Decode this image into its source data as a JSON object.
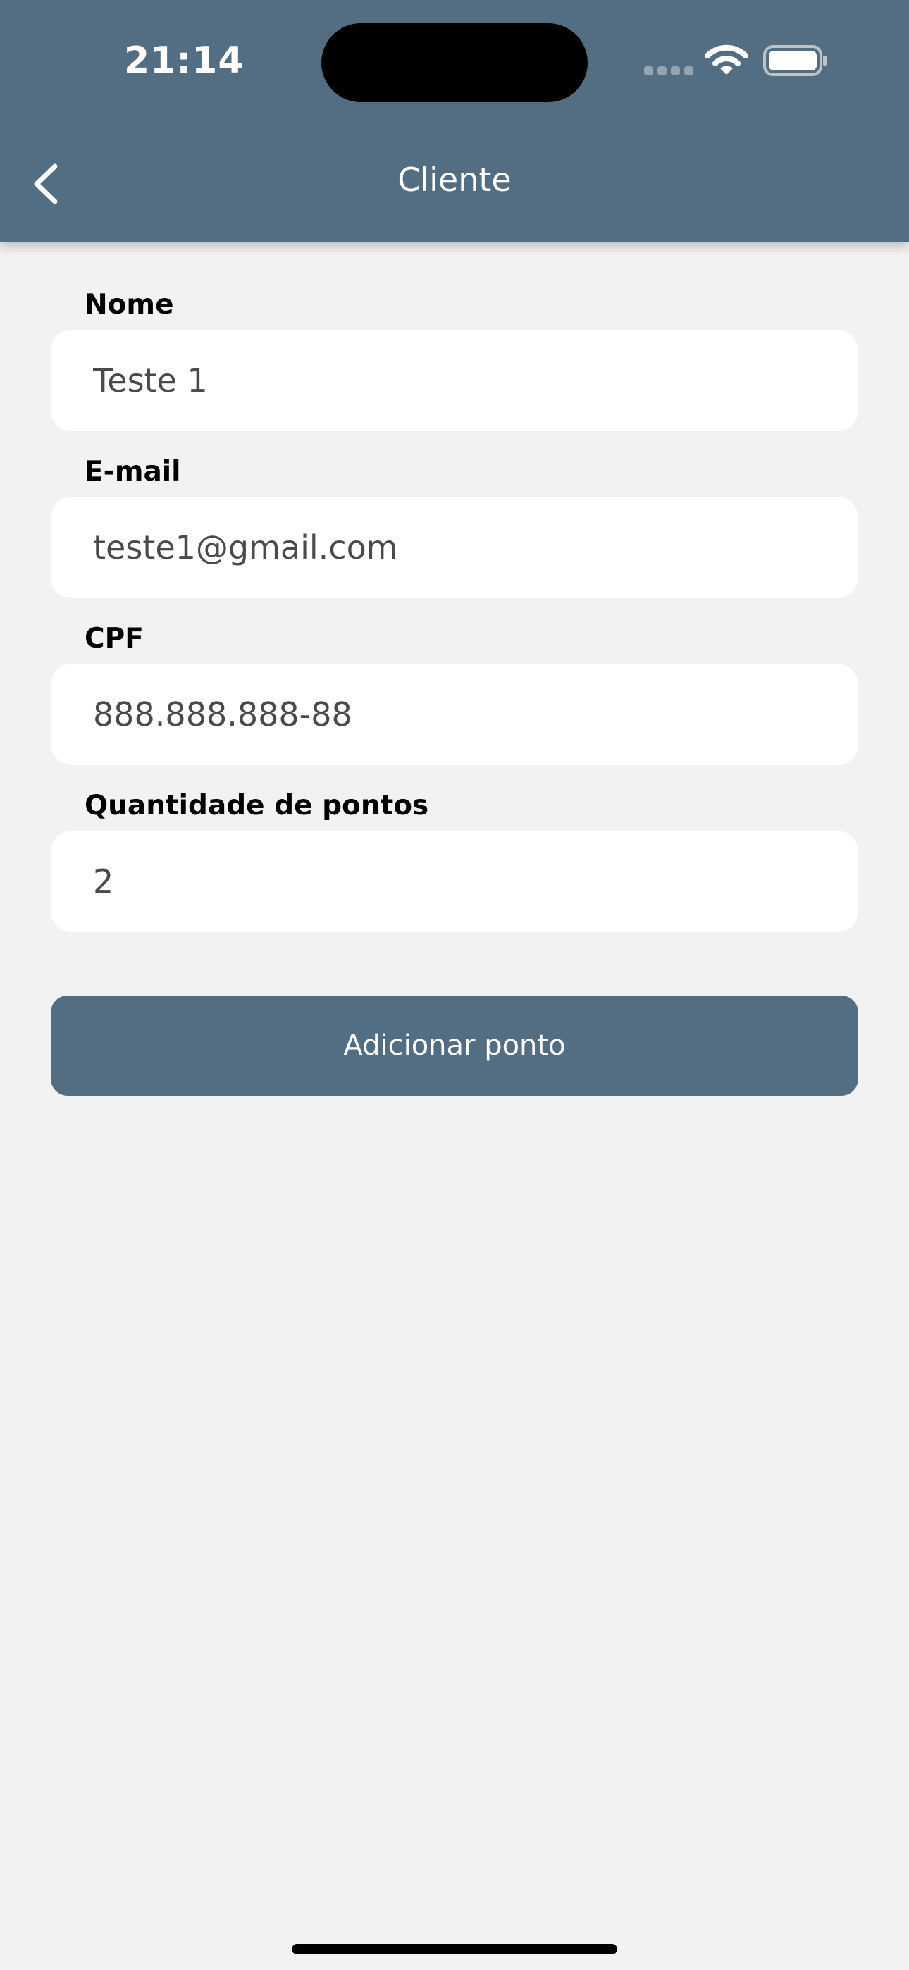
{
  "status_bar": {
    "time": "21:14"
  },
  "nav": {
    "title": "Cliente",
    "back_icon": "chevron-left-icon"
  },
  "form": {
    "nome": {
      "label": "Nome",
      "value": "Teste 1"
    },
    "email": {
      "label": "E-mail",
      "value": "teste1@gmail.com"
    },
    "cpf": {
      "label": "CPF",
      "value": "888.888.888-88"
    },
    "pontos": {
      "label": "Quantidade de pontos",
      "value": "2"
    }
  },
  "actions": {
    "add_point_label": "Adicionar ponto"
  },
  "colors": {
    "header": "#536d82",
    "background": "#f2f2f2",
    "input_background": "#ffffff",
    "button": "#536d82"
  }
}
